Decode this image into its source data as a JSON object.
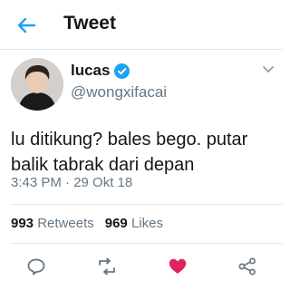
{
  "header": {
    "title": "Tweet",
    "back_icon": "arrow-left-icon",
    "accent": "#1da1f2"
  },
  "author": {
    "name": "lucas",
    "handle": "@wongxifacai",
    "verified": true,
    "verified_color": "#1da1f2"
  },
  "tweet": {
    "text": "lu ditikung? bales bego. putar balik tabrak dari depan",
    "timestamp": "3:43 PM · 29 Okt 18"
  },
  "stats": {
    "retweets_count": "993",
    "retweets_label": "Retweets",
    "likes_count": "969",
    "likes_label": "Likes"
  },
  "actions": [
    {
      "name": "reply",
      "icon": "comment-icon"
    },
    {
      "name": "retweet",
      "icon": "retweet-icon"
    },
    {
      "name": "like",
      "icon": "heart-icon",
      "active": true,
      "color": "#e0245e"
    },
    {
      "name": "share",
      "icon": "share-icon"
    }
  ]
}
